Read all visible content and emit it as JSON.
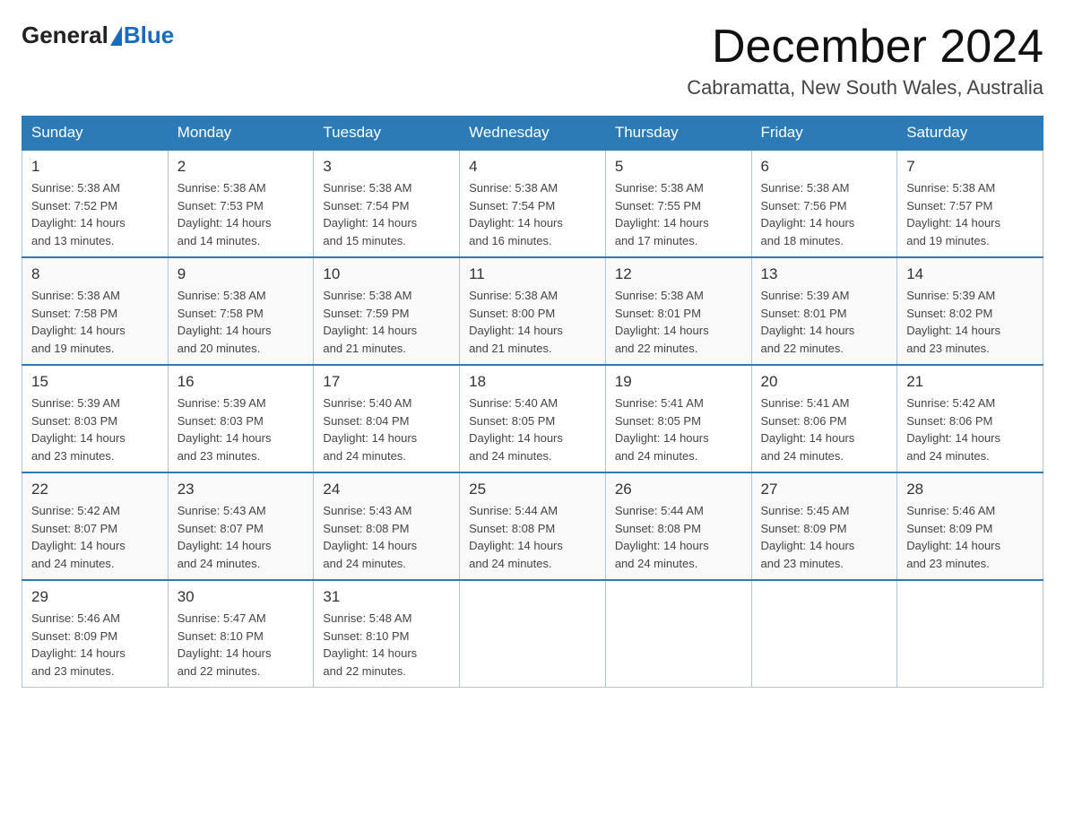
{
  "logo": {
    "general": "General",
    "blue": "Blue"
  },
  "title": "December 2024",
  "subtitle": "Cabramatta, New South Wales, Australia",
  "days_of_week": [
    "Sunday",
    "Monday",
    "Tuesday",
    "Wednesday",
    "Thursday",
    "Friday",
    "Saturday"
  ],
  "weeks": [
    [
      {
        "day": "1",
        "sunrise": "5:38 AM",
        "sunset": "7:52 PM",
        "daylight": "14 hours and 13 minutes."
      },
      {
        "day": "2",
        "sunrise": "5:38 AM",
        "sunset": "7:53 PM",
        "daylight": "14 hours and 14 minutes."
      },
      {
        "day": "3",
        "sunrise": "5:38 AM",
        "sunset": "7:54 PM",
        "daylight": "14 hours and 15 minutes."
      },
      {
        "day": "4",
        "sunrise": "5:38 AM",
        "sunset": "7:54 PM",
        "daylight": "14 hours and 16 minutes."
      },
      {
        "day": "5",
        "sunrise": "5:38 AM",
        "sunset": "7:55 PM",
        "daylight": "14 hours and 17 minutes."
      },
      {
        "day": "6",
        "sunrise": "5:38 AM",
        "sunset": "7:56 PM",
        "daylight": "14 hours and 18 minutes."
      },
      {
        "day": "7",
        "sunrise": "5:38 AM",
        "sunset": "7:57 PM",
        "daylight": "14 hours and 19 minutes."
      }
    ],
    [
      {
        "day": "8",
        "sunrise": "5:38 AM",
        "sunset": "7:58 PM",
        "daylight": "14 hours and 19 minutes."
      },
      {
        "day": "9",
        "sunrise": "5:38 AM",
        "sunset": "7:58 PM",
        "daylight": "14 hours and 20 minutes."
      },
      {
        "day": "10",
        "sunrise": "5:38 AM",
        "sunset": "7:59 PM",
        "daylight": "14 hours and 21 minutes."
      },
      {
        "day": "11",
        "sunrise": "5:38 AM",
        "sunset": "8:00 PM",
        "daylight": "14 hours and 21 minutes."
      },
      {
        "day": "12",
        "sunrise": "5:38 AM",
        "sunset": "8:01 PM",
        "daylight": "14 hours and 22 minutes."
      },
      {
        "day": "13",
        "sunrise": "5:39 AM",
        "sunset": "8:01 PM",
        "daylight": "14 hours and 22 minutes."
      },
      {
        "day": "14",
        "sunrise": "5:39 AM",
        "sunset": "8:02 PM",
        "daylight": "14 hours and 23 minutes."
      }
    ],
    [
      {
        "day": "15",
        "sunrise": "5:39 AM",
        "sunset": "8:03 PM",
        "daylight": "14 hours and 23 minutes."
      },
      {
        "day": "16",
        "sunrise": "5:39 AM",
        "sunset": "8:03 PM",
        "daylight": "14 hours and 23 minutes."
      },
      {
        "day": "17",
        "sunrise": "5:40 AM",
        "sunset": "8:04 PM",
        "daylight": "14 hours and 24 minutes."
      },
      {
        "day": "18",
        "sunrise": "5:40 AM",
        "sunset": "8:05 PM",
        "daylight": "14 hours and 24 minutes."
      },
      {
        "day": "19",
        "sunrise": "5:41 AM",
        "sunset": "8:05 PM",
        "daylight": "14 hours and 24 minutes."
      },
      {
        "day": "20",
        "sunrise": "5:41 AM",
        "sunset": "8:06 PM",
        "daylight": "14 hours and 24 minutes."
      },
      {
        "day": "21",
        "sunrise": "5:42 AM",
        "sunset": "8:06 PM",
        "daylight": "14 hours and 24 minutes."
      }
    ],
    [
      {
        "day": "22",
        "sunrise": "5:42 AM",
        "sunset": "8:07 PM",
        "daylight": "14 hours and 24 minutes."
      },
      {
        "day": "23",
        "sunrise": "5:43 AM",
        "sunset": "8:07 PM",
        "daylight": "14 hours and 24 minutes."
      },
      {
        "day": "24",
        "sunrise": "5:43 AM",
        "sunset": "8:08 PM",
        "daylight": "14 hours and 24 minutes."
      },
      {
        "day": "25",
        "sunrise": "5:44 AM",
        "sunset": "8:08 PM",
        "daylight": "14 hours and 24 minutes."
      },
      {
        "day": "26",
        "sunrise": "5:44 AM",
        "sunset": "8:08 PM",
        "daylight": "14 hours and 24 minutes."
      },
      {
        "day": "27",
        "sunrise": "5:45 AM",
        "sunset": "8:09 PM",
        "daylight": "14 hours and 23 minutes."
      },
      {
        "day": "28",
        "sunrise": "5:46 AM",
        "sunset": "8:09 PM",
        "daylight": "14 hours and 23 minutes."
      }
    ],
    [
      {
        "day": "29",
        "sunrise": "5:46 AM",
        "sunset": "8:09 PM",
        "daylight": "14 hours and 23 minutes."
      },
      {
        "day": "30",
        "sunrise": "5:47 AM",
        "sunset": "8:10 PM",
        "daylight": "14 hours and 22 minutes."
      },
      {
        "day": "31",
        "sunrise": "5:48 AM",
        "sunset": "8:10 PM",
        "daylight": "14 hours and 22 minutes."
      },
      null,
      null,
      null,
      null
    ]
  ],
  "labels": {
    "sunrise": "Sunrise:",
    "sunset": "Sunset:",
    "daylight": "Daylight:"
  }
}
